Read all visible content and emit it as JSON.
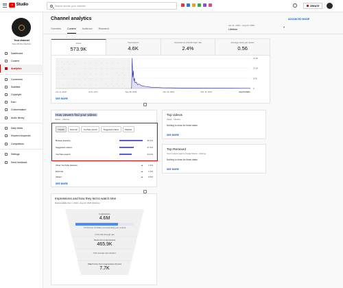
{
  "topbar": {
    "logo_text": "Studio",
    "search_placeholder": "Search across your channel",
    "create_label": "CREATE",
    "help_glyph": "?"
  },
  "sidebar": {
    "channel_title": "Your channel",
    "channel_subtitle": "New Mirrine Fashion",
    "items": [
      {
        "label": "Dashboard",
        "icon": "dashboard-icon"
      },
      {
        "label": "Content",
        "icon": "content-icon"
      },
      {
        "label": "Analytics",
        "icon": "analytics-icon",
        "active": true
      },
      {
        "label": "Comments",
        "icon": "comments-icon"
      },
      {
        "label": "Subtitles",
        "icon": "subtitles-icon"
      },
      {
        "label": "Copyright",
        "icon": "copyright-icon"
      },
      {
        "label": "Earn",
        "icon": "earn-icon"
      },
      {
        "label": "Customisation",
        "icon": "customisation-icon"
      },
      {
        "label": "Audio library",
        "icon": "audio-library-icon"
      },
      {
        "label": "Daily ideas",
        "icon": "daily-ideas-icon"
      },
      {
        "label": "Keyword inspector",
        "icon": "keyword-inspector-icon"
      },
      {
        "label": "Competitors",
        "icon": "competitors-icon"
      },
      {
        "label": "Settings",
        "icon": "settings-icon"
      },
      {
        "label": "Send feedback",
        "icon": "send-feedback-icon"
      }
    ]
  },
  "header": {
    "title": "Channel analytics",
    "advanced_mode": "ADVANCED MODE",
    "tabs": [
      "Overview",
      "Content",
      "Audience",
      "Research"
    ],
    "active_tab": "Content",
    "date_range": "Apr 11, 2016 – Aug 23, 2022",
    "date_label": "Lifetime"
  },
  "metrics": [
    {
      "label": "Views",
      "value": "573.9K",
      "active": true
    },
    {
      "label": "Impressions",
      "value": "4.6K"
    },
    {
      "label": "Impressions click-through rate",
      "value": "2.4%"
    },
    {
      "label": "Average views per viewer",
      "value": "0.56"
    }
  ],
  "chart_data": {
    "type": "area",
    "x_ticks": [
      "Apr 11, 2016",
      "Jul 5, 2017",
      "Sep 28, 2018",
      "Dec 22, 2019",
      "Mar 16, 2021",
      "Jun 8, 2022",
      "Aug 23, 2022"
    ],
    "y_ticks": [
      "24.0K",
      "16.0K",
      "8.0K",
      "0"
    ],
    "ylim": [
      0,
      24000
    ],
    "shaded_region": [
      "Apr 11, 2016",
      "Sep 28, 2018"
    ],
    "series": [
      {
        "values": [
          [
            "Sep 28, 2018",
            0
          ],
          [
            "Oct 5, 2018",
            300
          ],
          [
            "Oct 12, 2018",
            24000
          ],
          [
            "Oct 19, 2018",
            9000
          ],
          [
            "Oct 26, 2018",
            14000
          ],
          [
            "Nov 2, 2018",
            6000
          ],
          [
            "Nov 9, 2018",
            8000
          ],
          [
            "Nov 16, 2018",
            4500
          ],
          [
            "Dec 1, 2018",
            5000
          ],
          [
            "Dec 15, 2018",
            3000
          ],
          [
            "Jan 1, 2019",
            3500
          ],
          [
            "Feb 1, 2019",
            2200
          ],
          [
            "Mar 1, 2019",
            1800
          ],
          [
            "Apr 1, 2019",
            1500
          ],
          [
            "May 1, 2019",
            1200
          ],
          [
            "Jun 1, 2019",
            900
          ],
          [
            "Aug 1, 2019",
            800
          ],
          [
            "Oct 1, 2019",
            600
          ],
          [
            "Dec 22, 2019",
            500
          ],
          [
            "Jun 1, 2020",
            400
          ],
          [
            "Mar 16, 2021",
            300
          ],
          [
            "Jan 1, 2022",
            250
          ],
          [
            "Aug 23, 2022",
            200
          ]
        ]
      }
    ],
    "color": "#2c2ca8"
  },
  "main_see_more": "SEE MORE",
  "traffic": {
    "title": "How viewers find your videos",
    "subtitle": "Views · Lifetime",
    "chips": [
      "Overall",
      "External",
      "YouTube search",
      "Suggested videos",
      "Playlists"
    ],
    "active_chip": "Overall",
    "rows": [
      {
        "name": "Browse features",
        "pct": "45.2%",
        "value": 45.2
      },
      {
        "name": "Suggested videos",
        "pct": "27.4%",
        "value": 27.4
      },
      {
        "name": "YouTube search",
        "pct": "24.0%",
        "value": 24.0
      }
    ],
    "extra_rows": [
      {
        "name": "Other YouTube features",
        "pct": "1.4%"
      },
      {
        "name": "External",
        "pct": "1.4%"
      },
      {
        "name": "Others",
        "pct": "0.6%"
      }
    ],
    "see_more": "SEE MORE"
  },
  "top_videos": {
    "title": "Top videos",
    "subtitle": "Views · Lifetime",
    "body": "Nothing to show for these dates",
    "see_more": "SEE MORE"
  },
  "top_remixed": {
    "title": "Top Remixed",
    "subtitle": "Your content used to create Shorts · Lifetime",
    "body": "Nothing to show for these dates",
    "see_more": "SEE MORE"
  },
  "funnel": {
    "title": "Impressions and how they led to watch time",
    "subtitle": "Data available Dec 1, 2019 – Aug 23, 2022 (Lifetime)",
    "impressions_label": "Impressions",
    "impressions_value": "4.6M",
    "bar_note": "73.3% from YouTube recommending your content",
    "bar_fraction": 0.733,
    "ctr_note": "2.4% click-through rate",
    "views_label": "Views from impressions",
    "views_value": "465.9K",
    "watch_note": "0.93 average view duration",
    "watch_label": "Watch time from impressions (hours)",
    "watch_value": "7.7K"
  }
}
